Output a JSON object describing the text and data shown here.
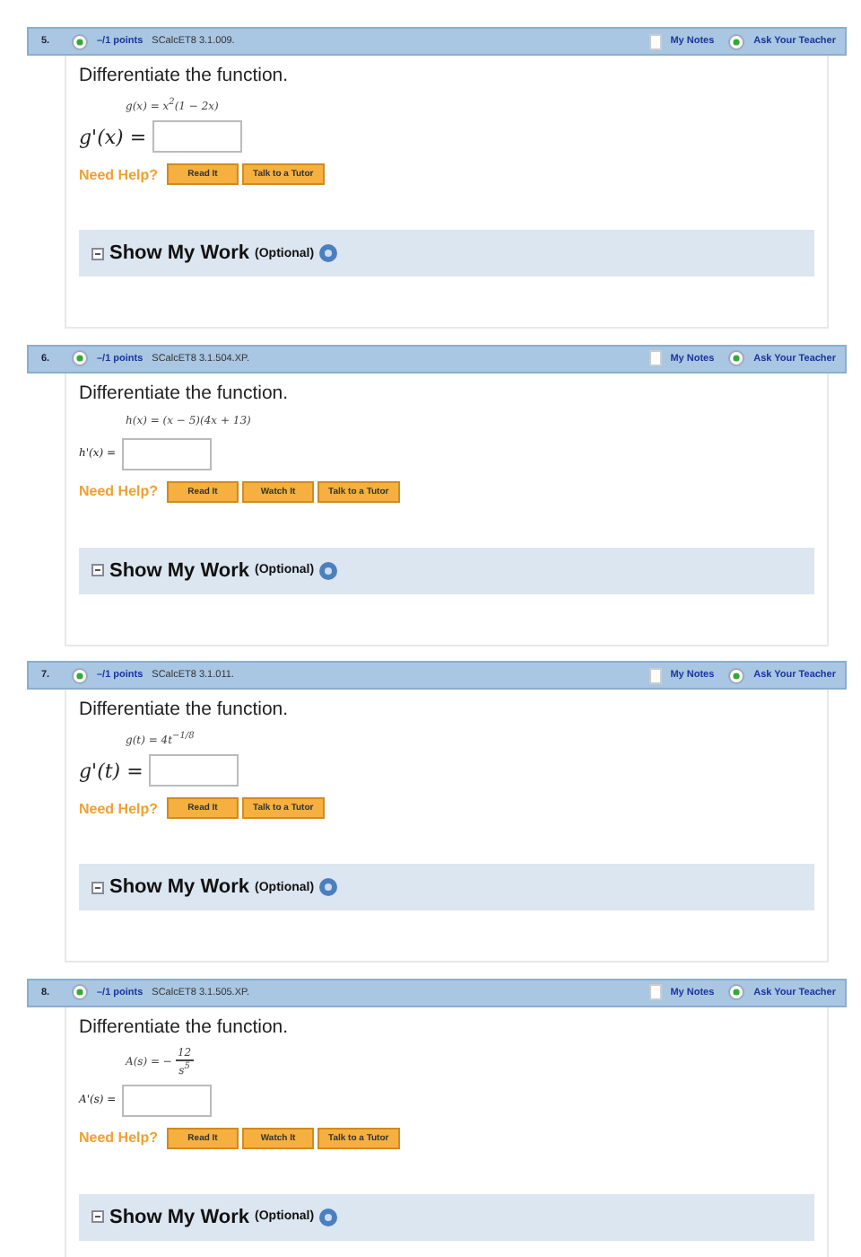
{
  "problems": [
    {
      "number": "5.",
      "points": "–/1 points",
      "code": "SCalcET8 3.1.009.",
      "notes": "My Notes",
      "ask": "Ask Your Teacher",
      "prompt": "Differentiate the function.",
      "function": {
        "kind": "inline",
        "text": "g(x) = x$^{2}$(1 − 2x)"
      },
      "answer": {
        "label": "g'(x) =",
        "kind": "large"
      },
      "help_label": "Need Help?",
      "help_buttons": [
        "Read It",
        "Talk to a Tutor"
      ],
      "work_title": "Show My Work",
      "work_note": "(Optional)"
    },
    {
      "number": "6.",
      "points": "–/1 points",
      "code": "SCalcET8 3.1.504.XP.",
      "notes": "My Notes",
      "ask": "Ask Your Teacher",
      "prompt": "Differentiate the function.",
      "function": {
        "kind": "inline",
        "text": "h(x) = (x − 5)(4x + 13)"
      },
      "answer": {
        "label": "h'(x) =",
        "kind": "small"
      },
      "help_label": "Need Help?",
      "help_buttons": [
        "Read It",
        "Watch It",
        "Talk to a Tutor"
      ],
      "work_title": "Show My Work",
      "work_note": "(Optional)"
    },
    {
      "number": "7.",
      "points": "–/1 points",
      "code": "SCalcET8 3.1.011.",
      "notes": "My Notes",
      "ask": "Ask Your Teacher",
      "prompt": "Differentiate the function.",
      "function": {
        "kind": "inline",
        "text": "g(t) = 4t$^{−1/8}$"
      },
      "answer": {
        "label": "g'(t) =",
        "kind": "large"
      },
      "help_label": "Need Help?",
      "help_buttons": [
        "Read It",
        "Talk to a Tutor"
      ],
      "work_title": "Show My Work",
      "work_note": "(Optional)"
    },
    {
      "number": "8.",
      "points": "–/1 points",
      "code": "SCalcET8 3.1.505.XP.",
      "notes": "My Notes",
      "ask": "Ask Your Teacher",
      "prompt": "Differentiate the function.",
      "function": {
        "kind": "fraction",
        "lhs": "A(s) = −",
        "numerator": "12",
        "denominator": "s$^{5}$"
      },
      "answer": {
        "label": "A'(s) =",
        "kind": "small"
      },
      "help_label": "Need Help?",
      "help_buttons": [
        "Read It",
        "Watch It",
        "Talk to a Tutor"
      ],
      "work_title": "Show My Work",
      "work_note": "(Optional)"
    }
  ]
}
